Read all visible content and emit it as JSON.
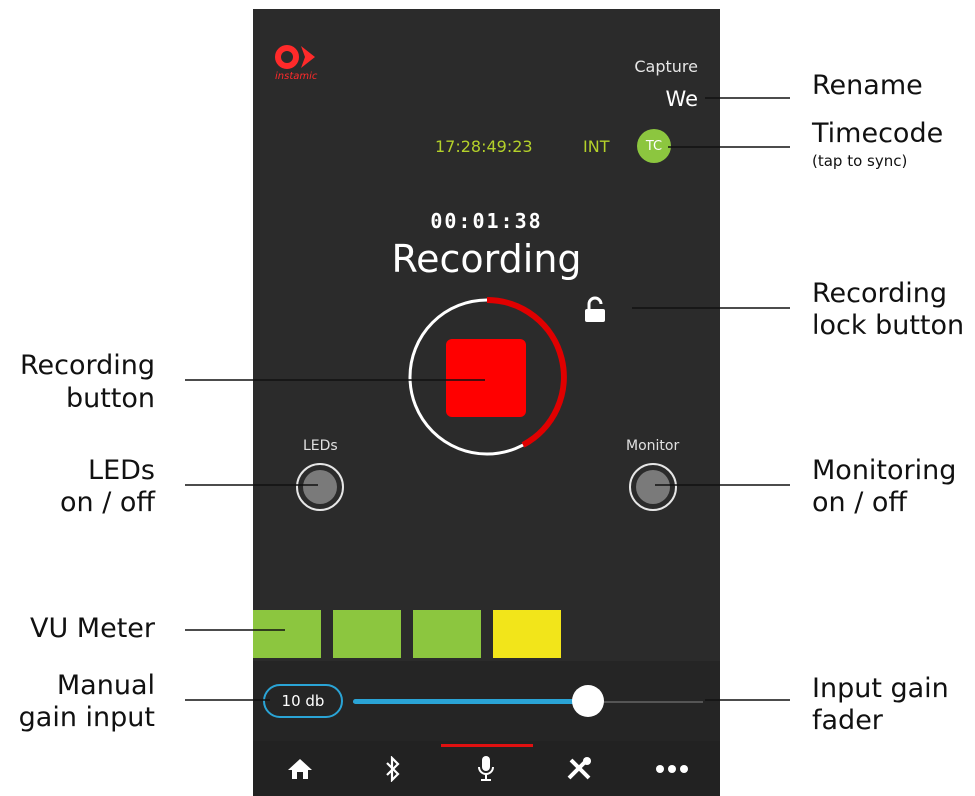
{
  "app": {
    "logo_text": "instamic",
    "capture_label": "Capture",
    "name_value": "We"
  },
  "timecode": {
    "time": "17:28:49:23",
    "source": "INT",
    "button_label": "TC"
  },
  "recording": {
    "elapsed": "00:01:38",
    "state": "Recording"
  },
  "toggles": {
    "leds_label": "LEDs",
    "monitor_label": "Monitor"
  },
  "vu_meter": {
    "blocks": [
      {
        "color": "#8cc63f"
      },
      {
        "color": "#8cc63f"
      },
      {
        "color": "#8cc63f"
      },
      {
        "color": "#f2e51a"
      }
    ]
  },
  "gain": {
    "value_label": "10 db",
    "fader_level": 0.67
  },
  "tabs": [
    {
      "icon": "home-icon",
      "active": false
    },
    {
      "icon": "bluetooth-icon",
      "active": false
    },
    {
      "icon": "microphone-icon",
      "active": true
    },
    {
      "icon": "tools-icon",
      "active": false
    },
    {
      "icon": "more-icon",
      "active": false
    }
  ],
  "callouts": {
    "rename": "Rename",
    "timecode": "Timecode",
    "timecode_sub": "(tap to sync)",
    "lock_line1": "Recording",
    "lock_line2": "lock button",
    "rec_line1": "Recording",
    "rec_line2": "button",
    "leds_line1": "LEDs",
    "leds_line2": "on / off",
    "monitoring_line1": "Monitoring",
    "monitoring_line2": "on / off",
    "vu": "VU Meter",
    "manual_line1": "Manual",
    "manual_line2": "gain input",
    "fader_line1": "Input gain",
    "fader_line2": "fader"
  },
  "colors": {
    "background": "#2b2b2b",
    "record_red": "#ff0000",
    "timecode_green": "#b4d12a",
    "accent_blue": "#2aa4d6"
  }
}
